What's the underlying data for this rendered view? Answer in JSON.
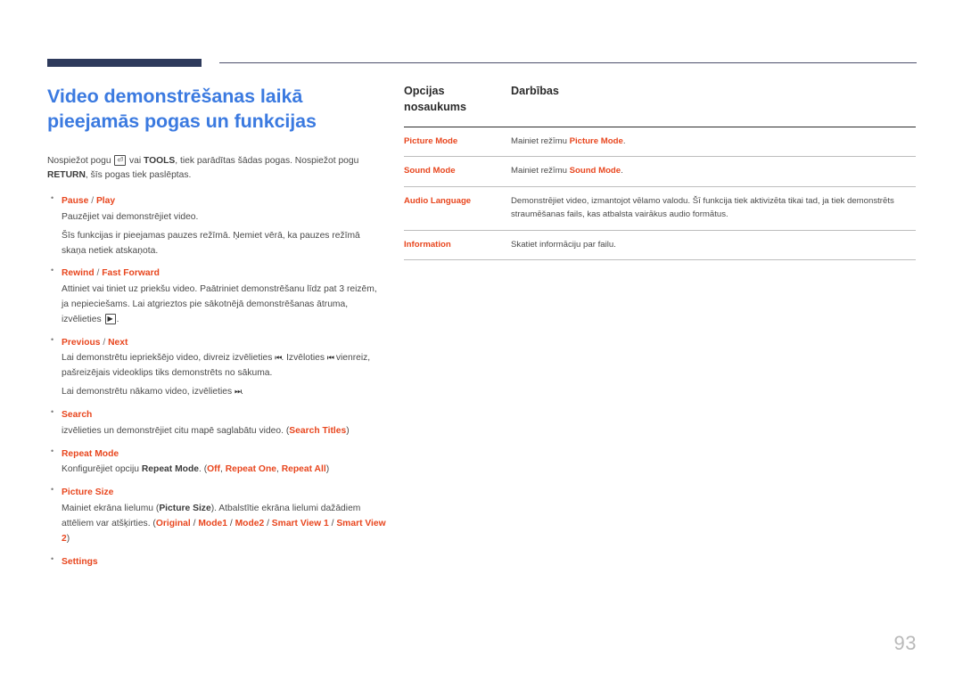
{
  "document": {
    "title_line1": "Video demonstrēšanas laikā",
    "title_line2": "pieejamās pogas un funkcijas",
    "page_number": "93",
    "colors": {
      "title_blue": "#3b7ae0",
      "accent_orange": "#e8461e",
      "deco_navy": "#2e3a5c",
      "body_gray": "#4a4a4a"
    }
  },
  "intro": {
    "part1": "Nospiežot pogu ",
    "enter_key_icon": "enter-key-icon",
    "part2": " vai ",
    "tools_label": "TOOLS",
    "part3": ", tiek parādītas šādas pogas. Nospiežot pogu ",
    "return_label": "RETURN",
    "part4": ", šīs pogas tiek paslēptas."
  },
  "bullets": [
    {
      "head_primary": "Pause",
      "head_sep": " / ",
      "head_secondary": "Play",
      "paragraphs": [
        "Pauzējiet vai demonstrējiet video.",
        "Šīs funkcijas ir pieejamas pauzes režīmā. Ņemiet vērā, ka pauzes režīmā skaņa netiek atskaņota."
      ]
    },
    {
      "head_primary": "Rewind",
      "head_sep": " / ",
      "head_secondary": "Fast Forward",
      "paragraphs": [
        "Attiniet vai tiniet uz priekšu video. Paātriniet demonstrēšanu līdz pat 3 reizēm, ja nepieciešams. Lai atgrieztos pie sākotnējā demonstrēšanas ātruma, izvēlieties ",
        "."
      ],
      "inline_icon": "play-button-icon"
    },
    {
      "head_primary": "Previous",
      "head_sep": " / ",
      "head_secondary": "Next",
      "paragraphs": [
        "Lai demonstrētu iepriekšējo video, divreiz izvēlieties ",
        ". Izvēloties ",
        " vienreiz, pašreizējais videoklips tiks demonstrēts no sākuma.",
        "Lai demonstrētu nākamo video, izvēlieties ",
        "."
      ],
      "icons": [
        "skip-backward-icon",
        "skip-backward-icon",
        "skip-forward-icon"
      ]
    },
    {
      "head_primary": "Search",
      "head_sep": "",
      "head_secondary": "",
      "paragraphs": [
        "izvēlieties un demonstrējiet citu mapē saglabātu video. (",
        "Search Titles",
        ")"
      ]
    },
    {
      "head_primary": "Repeat Mode",
      "head_sep": "",
      "head_secondary": "",
      "paragraphs": [
        "Konfigurējiet opciju ",
        "Repeat Mode",
        ". (",
        "Off",
        ", ",
        "Repeat One",
        ", ",
        "Repeat All",
        ")"
      ]
    },
    {
      "head_primary": "Picture Size",
      "head_sep": "",
      "head_secondary": "",
      "paragraphs": [
        "Mainiet ekrāna lielumu (",
        "Picture Size",
        "). Atbalstītie ekrāna lielumi dažādiem attēliem var atšķirties. (",
        "Original",
        " / ",
        "Mode1",
        " / ",
        "Mode2",
        " / ",
        "Smart View 1",
        " / ",
        "Smart View 2",
        ")"
      ]
    },
    {
      "head_primary": "Settings",
      "head_sep": "",
      "head_secondary": "",
      "paragraphs": []
    }
  ],
  "options_table": {
    "headers": {
      "col1_line1": "Opcijas",
      "col1_line2": "nosaukums",
      "col2": "Darbības"
    },
    "rows": [
      {
        "name": "Picture Mode",
        "desc_pre": "Mainiet režīmu ",
        "desc_bold": "Picture Mode",
        "desc_post": "."
      },
      {
        "name": "Sound Mode",
        "desc_pre": "Mainiet režīmu ",
        "desc_bold": "Sound Mode",
        "desc_post": "."
      },
      {
        "name": "Audio Language",
        "desc_pre": "Demonstrējiet video, izmantojot vēlamo valodu. Šī funkcija tiek aktivizēta tikai tad, ja tiek demonstrēts straumēšanas fails, kas atbalsta vairākus audio formātus.",
        "desc_bold": "",
        "desc_post": ""
      },
      {
        "name": "Information",
        "desc_pre": "Skatiet informāciju par failu.",
        "desc_bold": "",
        "desc_post": ""
      }
    ]
  }
}
